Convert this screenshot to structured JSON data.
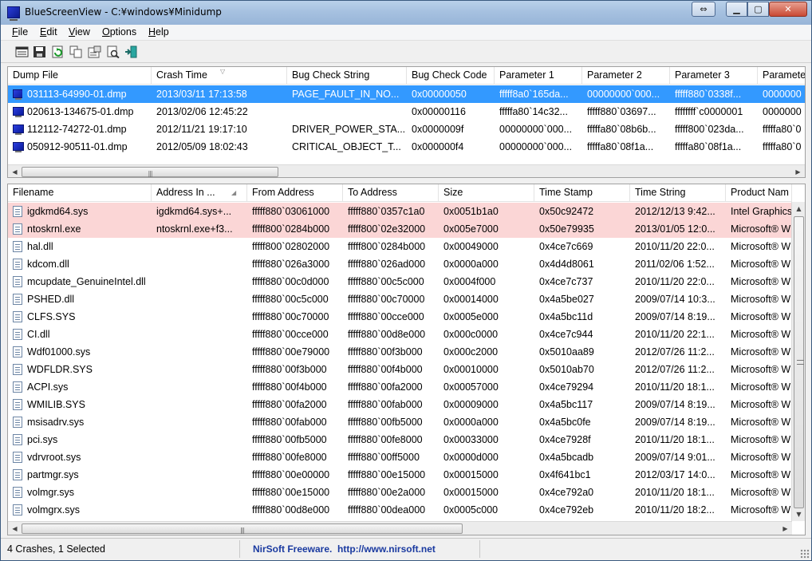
{
  "window": {
    "title": "BlueScreenView  -  C:¥windows¥Minidump"
  },
  "menu": [
    {
      "label": "File",
      "ul": "F",
      "rest": "ile"
    },
    {
      "label": "Edit",
      "ul": "E",
      "rest": "dit"
    },
    {
      "label": "View",
      "ul": "V",
      "rest": "iew"
    },
    {
      "label": "Options",
      "ul": "O",
      "rest": "ptions"
    },
    {
      "label": "Help",
      "ul": "H",
      "rest": "elp"
    }
  ],
  "toolbar": {
    "buttons": [
      "html-report-icon",
      "save-icon",
      "refresh-icon",
      "copy-icon",
      "properties-icon",
      "find-icon",
      "exit-icon"
    ]
  },
  "crashes": {
    "columns": [
      "Dump File",
      "Crash Time",
      "Bug Check String",
      "Bug Check Code",
      "Parameter 1",
      "Parameter 2",
      "Parameter 3",
      "Paramete"
    ],
    "rows": [
      [
        "031113-64990-01.dmp",
        "2013/03/11 17:13:58",
        "PAGE_FAULT_IN_NO...",
        "0x00000050",
        "fffff8a0`165da...",
        "00000000`000...",
        "fffff880`0338f...",
        "0000000"
      ],
      [
        "020613-134675-01.dmp",
        "2013/02/06 12:45:22",
        "",
        "0x00000116",
        "fffffa80`14c32...",
        "fffff880`03697...",
        "ffffffff`c0000001",
        "0000000"
      ],
      [
        "112112-74272-01.dmp",
        "2012/11/21 19:17:10",
        "DRIVER_POWER_STA...",
        "0x0000009f",
        "00000000`000...",
        "fffffa80`08b6b...",
        "fffff800`023da...",
        "fffffa80`0"
      ],
      [
        "050912-90511-01.dmp",
        "2012/05/09 18:02:43",
        "CRITICAL_OBJECT_T...",
        "0x000000f4",
        "00000000`000...",
        "fffffa80`08f1a...",
        "fffffa80`08f1a...",
        "fffffa80`0"
      ]
    ],
    "selected_index": 0
  },
  "drivers": {
    "columns": [
      "Filename",
      "Address In ...",
      "From Address",
      "To Address",
      "Size",
      "Time Stamp",
      "Time String",
      "Product Nam"
    ],
    "rows": [
      [
        "igdkmd64.sys",
        "igdkmd64.sys+...",
        "fffff880`03061000",
        "fffff880`0357c1a0",
        "0x0051b1a0",
        "0x50c92472",
        "2012/12/13 9:42...",
        "Intel Graphics"
      ],
      [
        "ntoskrnl.exe",
        "ntoskrnl.exe+f3...",
        "fffff800`0284b000",
        "fffff800`02e32000",
        "0x005e7000",
        "0x50e79935",
        "2013/01/05 12:0...",
        "Microsoft® W"
      ],
      [
        "hal.dll",
        "",
        "fffff800`02802000",
        "fffff800`0284b000",
        "0x00049000",
        "0x4ce7c669",
        "2010/11/20 22:0...",
        "Microsoft® W"
      ],
      [
        "kdcom.dll",
        "",
        "fffff880`026a3000",
        "fffff880`026ad000",
        "0x0000a000",
        "0x4d4d8061",
        "2011/02/06 1:52...",
        "Microsoft® W"
      ],
      [
        "mcupdate_GenuineIntel.dll",
        "",
        "fffff880`00c0d000",
        "fffff880`00c5c000",
        "0x0004f000",
        "0x4ce7c737",
        "2010/11/20 22:0...",
        "Microsoft® W"
      ],
      [
        "PSHED.dll",
        "",
        "fffff880`00c5c000",
        "fffff880`00c70000",
        "0x00014000",
        "0x4a5be027",
        "2009/07/14 10:3...",
        "Microsoft® W"
      ],
      [
        "CLFS.SYS",
        "",
        "fffff880`00c70000",
        "fffff880`00cce000",
        "0x0005e000",
        "0x4a5bc11d",
        "2009/07/14 8:19...",
        "Microsoft® W"
      ],
      [
        "CI.dll",
        "",
        "fffff880`00cce000",
        "fffff880`00d8e000",
        "0x000c0000",
        "0x4ce7c944",
        "2010/11/20 22:1...",
        "Microsoft® W"
      ],
      [
        "Wdf01000.sys",
        "",
        "fffff880`00e79000",
        "fffff880`00f3b000",
        "0x000c2000",
        "0x5010aa89",
        "2012/07/26 11:2...",
        "Microsoft® W"
      ],
      [
        "WDFLDR.SYS",
        "",
        "fffff880`00f3b000",
        "fffff880`00f4b000",
        "0x00010000",
        "0x5010ab70",
        "2012/07/26 11:2...",
        "Microsoft® W"
      ],
      [
        "ACPI.sys",
        "",
        "fffff880`00f4b000",
        "fffff880`00fa2000",
        "0x00057000",
        "0x4ce79294",
        "2010/11/20 18:1...",
        "Microsoft® W"
      ],
      [
        "WMILIB.SYS",
        "",
        "fffff880`00fa2000",
        "fffff880`00fab000",
        "0x00009000",
        "0x4a5bc117",
        "2009/07/14 8:19...",
        "Microsoft® W"
      ],
      [
        "msisadrv.sys",
        "",
        "fffff880`00fab000",
        "fffff880`00fb5000",
        "0x0000a000",
        "0x4a5bc0fe",
        "2009/07/14 8:19...",
        "Microsoft® W"
      ],
      [
        "pci.sys",
        "",
        "fffff880`00fb5000",
        "fffff880`00fe8000",
        "0x00033000",
        "0x4ce7928f",
        "2010/11/20 18:1...",
        "Microsoft® W"
      ],
      [
        "vdrvroot.sys",
        "",
        "fffff880`00fe8000",
        "fffff880`00ff5000",
        "0x0000d000",
        "0x4a5bcadb",
        "2009/07/14 9:01...",
        "Microsoft® W"
      ],
      [
        "partmgr.sys",
        "",
        "fffff880`00e00000",
        "fffff880`00e15000",
        "0x00015000",
        "0x4f641bc1",
        "2012/03/17 14:0...",
        "Microsoft® W"
      ],
      [
        "volmgr.sys",
        "",
        "fffff880`00e15000",
        "fffff880`00e2a000",
        "0x00015000",
        "0x4ce792a0",
        "2010/11/20 18:1...",
        "Microsoft® W"
      ],
      [
        "volmgrx.sys",
        "",
        "fffff880`00d8e000",
        "fffff880`00dea000",
        "0x0005c000",
        "0x4ce792eb",
        "2010/11/20 18:2...",
        "Microsoft® W"
      ]
    ],
    "highlight_count": 2
  },
  "status": {
    "summary": "4 Crashes, 1 Selected",
    "link": "NirSoft Freeware.  http://www.nirsoft.net"
  },
  "colors": {
    "selection": "#3399ff",
    "highlight": "#fbd6d6",
    "link": "#1a3aa0"
  }
}
